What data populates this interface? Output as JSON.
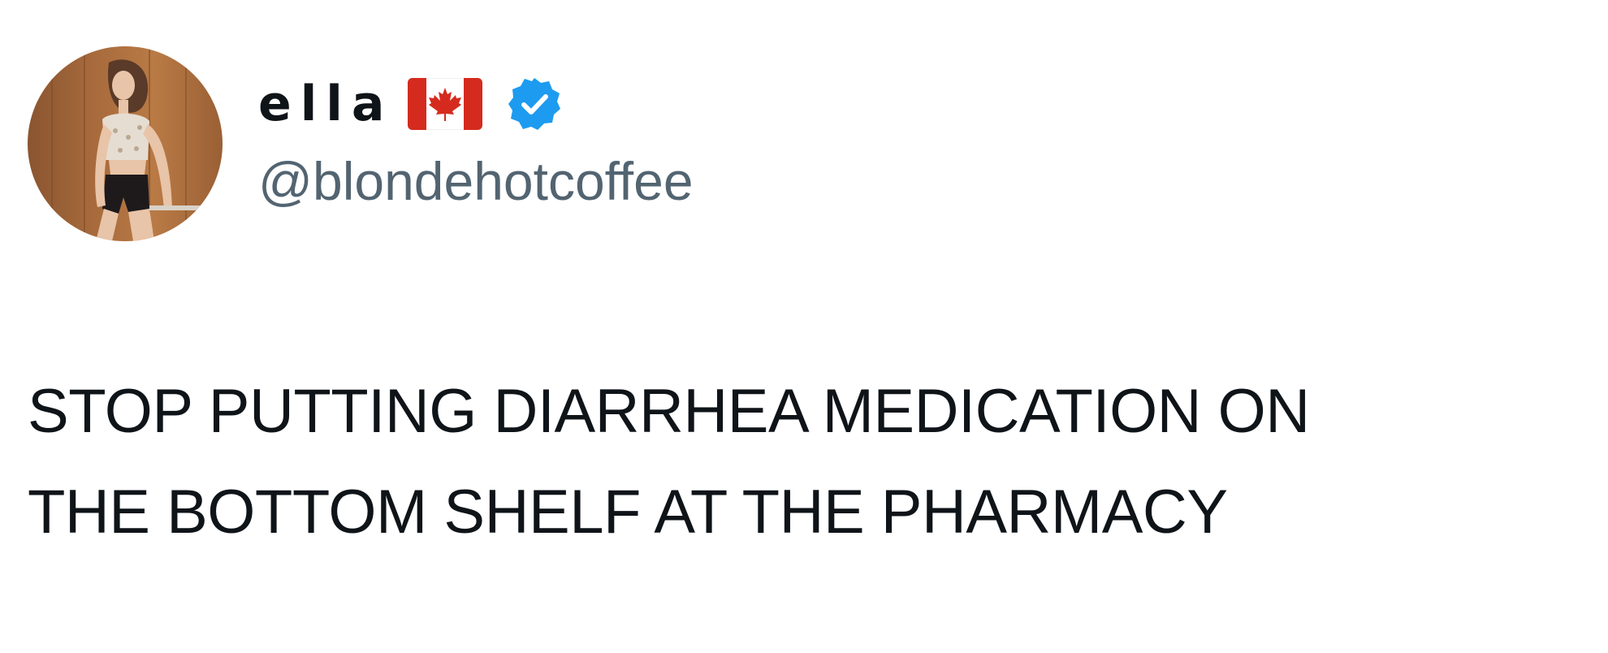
{
  "author": {
    "display_name": "ella",
    "flag_icon": "canada-flag-icon",
    "verified_icon": "verified-badge-icon",
    "handle": "@blondehotcoffee",
    "avatar_alt": "profile photo"
  },
  "tweet": {
    "lines": [
      "STOP PUTTING DIARRHEA MEDICATION ON",
      "THE BOTTOM SHELF AT THE PHARMACY"
    ]
  },
  "colors": {
    "text": "#0f1419",
    "handle": "#536471",
    "verified": "#1d9bf0",
    "flag_red": "#d52b1e"
  }
}
